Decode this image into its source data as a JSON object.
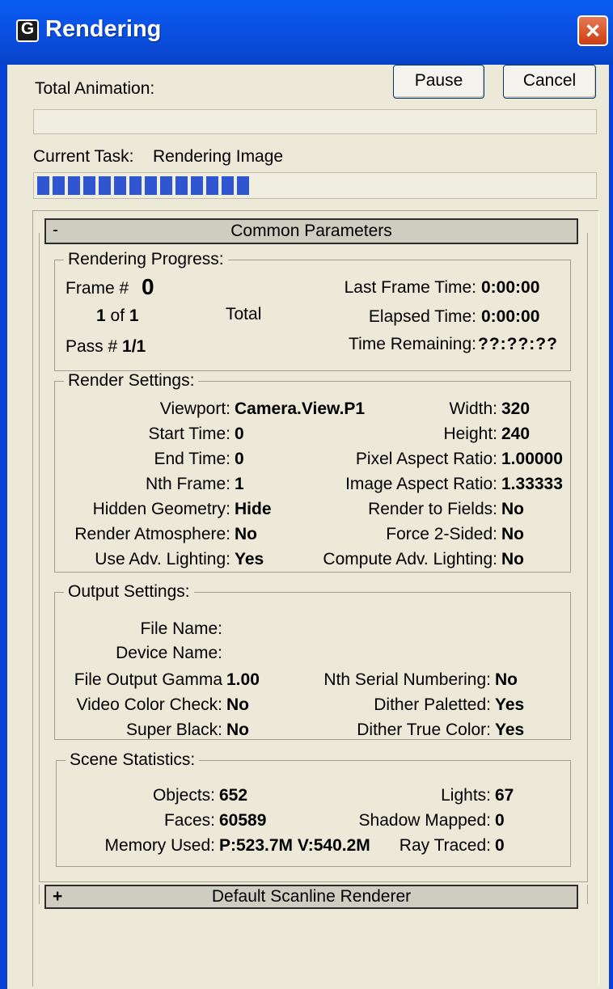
{
  "window": {
    "title": "Rendering",
    "close_icon": "×"
  },
  "header": {
    "total_animation_label": "Total Animation:",
    "pause_label": "Pause",
    "cancel_label": "Cancel",
    "current_task_label": "Current Task:",
    "current_task_value": "Rendering Image"
  },
  "progress": {
    "total_animation_fraction": 0.0,
    "current_task_fraction": 0.4
  },
  "common_parameters": {
    "toggle": "-",
    "title": "Common Parameters",
    "rendering_progress": {
      "title": "Rendering Progress:",
      "frame_label": "Frame #",
      "frame_value": "0",
      "count_current": "1",
      "count_of": "of",
      "count_total": "1",
      "total_label": "Total",
      "pass_label": "Pass #",
      "pass_value": "1/1",
      "last_frame_time_label": "Last Frame Time:",
      "last_frame_time_value": "0:00:00",
      "elapsed_time_label": "Elapsed Time:",
      "elapsed_time_value": "0:00:00",
      "time_remaining_label": "Time Remaining:",
      "time_remaining_value": "??:??:??"
    },
    "render_settings": {
      "title": "Render Settings:",
      "left": [
        {
          "label": "Viewport:",
          "value": "Camera.View.P1"
        },
        {
          "label": "Start Time:",
          "value": "0"
        },
        {
          "label": "End Time:",
          "value": "0"
        },
        {
          "label": "Nth Frame:",
          "value": "1"
        },
        {
          "label": "Hidden Geometry:",
          "value": "Hide"
        },
        {
          "label": "Render Atmosphere:",
          "value": "No"
        },
        {
          "label": "Use Adv. Lighting:",
          "value": "Yes"
        }
      ],
      "right": [
        {
          "label": "Width:",
          "value": "320"
        },
        {
          "label": "Height:",
          "value": "240"
        },
        {
          "label": "Pixel Aspect Ratio:",
          "value": "1.00000"
        },
        {
          "label": "Image Aspect Ratio:",
          "value": "1.33333"
        },
        {
          "label": "Render to Fields:",
          "value": "No"
        },
        {
          "label": "Force 2-Sided:",
          "value": "No"
        },
        {
          "label": "Compute Adv. Lighting:",
          "value": "No"
        }
      ]
    },
    "output_settings": {
      "title": "Output Settings:",
      "file_name_label": "File Name:",
      "device_name_label": "Device Name:",
      "left": [
        {
          "label": "File Output Gamma",
          "value": "1.00"
        },
        {
          "label": "Video Color Check:",
          "value": "No"
        },
        {
          "label": "Super Black:",
          "value": "No"
        }
      ],
      "right": [
        {
          "label": "Nth Serial Numbering:",
          "value": "No"
        },
        {
          "label": "Dither Paletted:",
          "value": "Yes"
        },
        {
          "label": "Dither True Color:",
          "value": "Yes"
        }
      ]
    },
    "scene_statistics": {
      "title": "Scene Statistics:",
      "left": [
        {
          "label": "Objects:",
          "value": "652"
        },
        {
          "label": "Faces:",
          "value": "60589"
        },
        {
          "label": "Memory Used:",
          "value": "P:523.7M V:540.2M"
        }
      ],
      "right": [
        {
          "label": "Lights:",
          "value": "67"
        },
        {
          "label": "Shadow Mapped:",
          "value": "0"
        },
        {
          "label": "Ray Traced:",
          "value": "0"
        }
      ]
    }
  },
  "default_scanline": {
    "toggle": "+",
    "title": "Default Scanline Renderer"
  }
}
